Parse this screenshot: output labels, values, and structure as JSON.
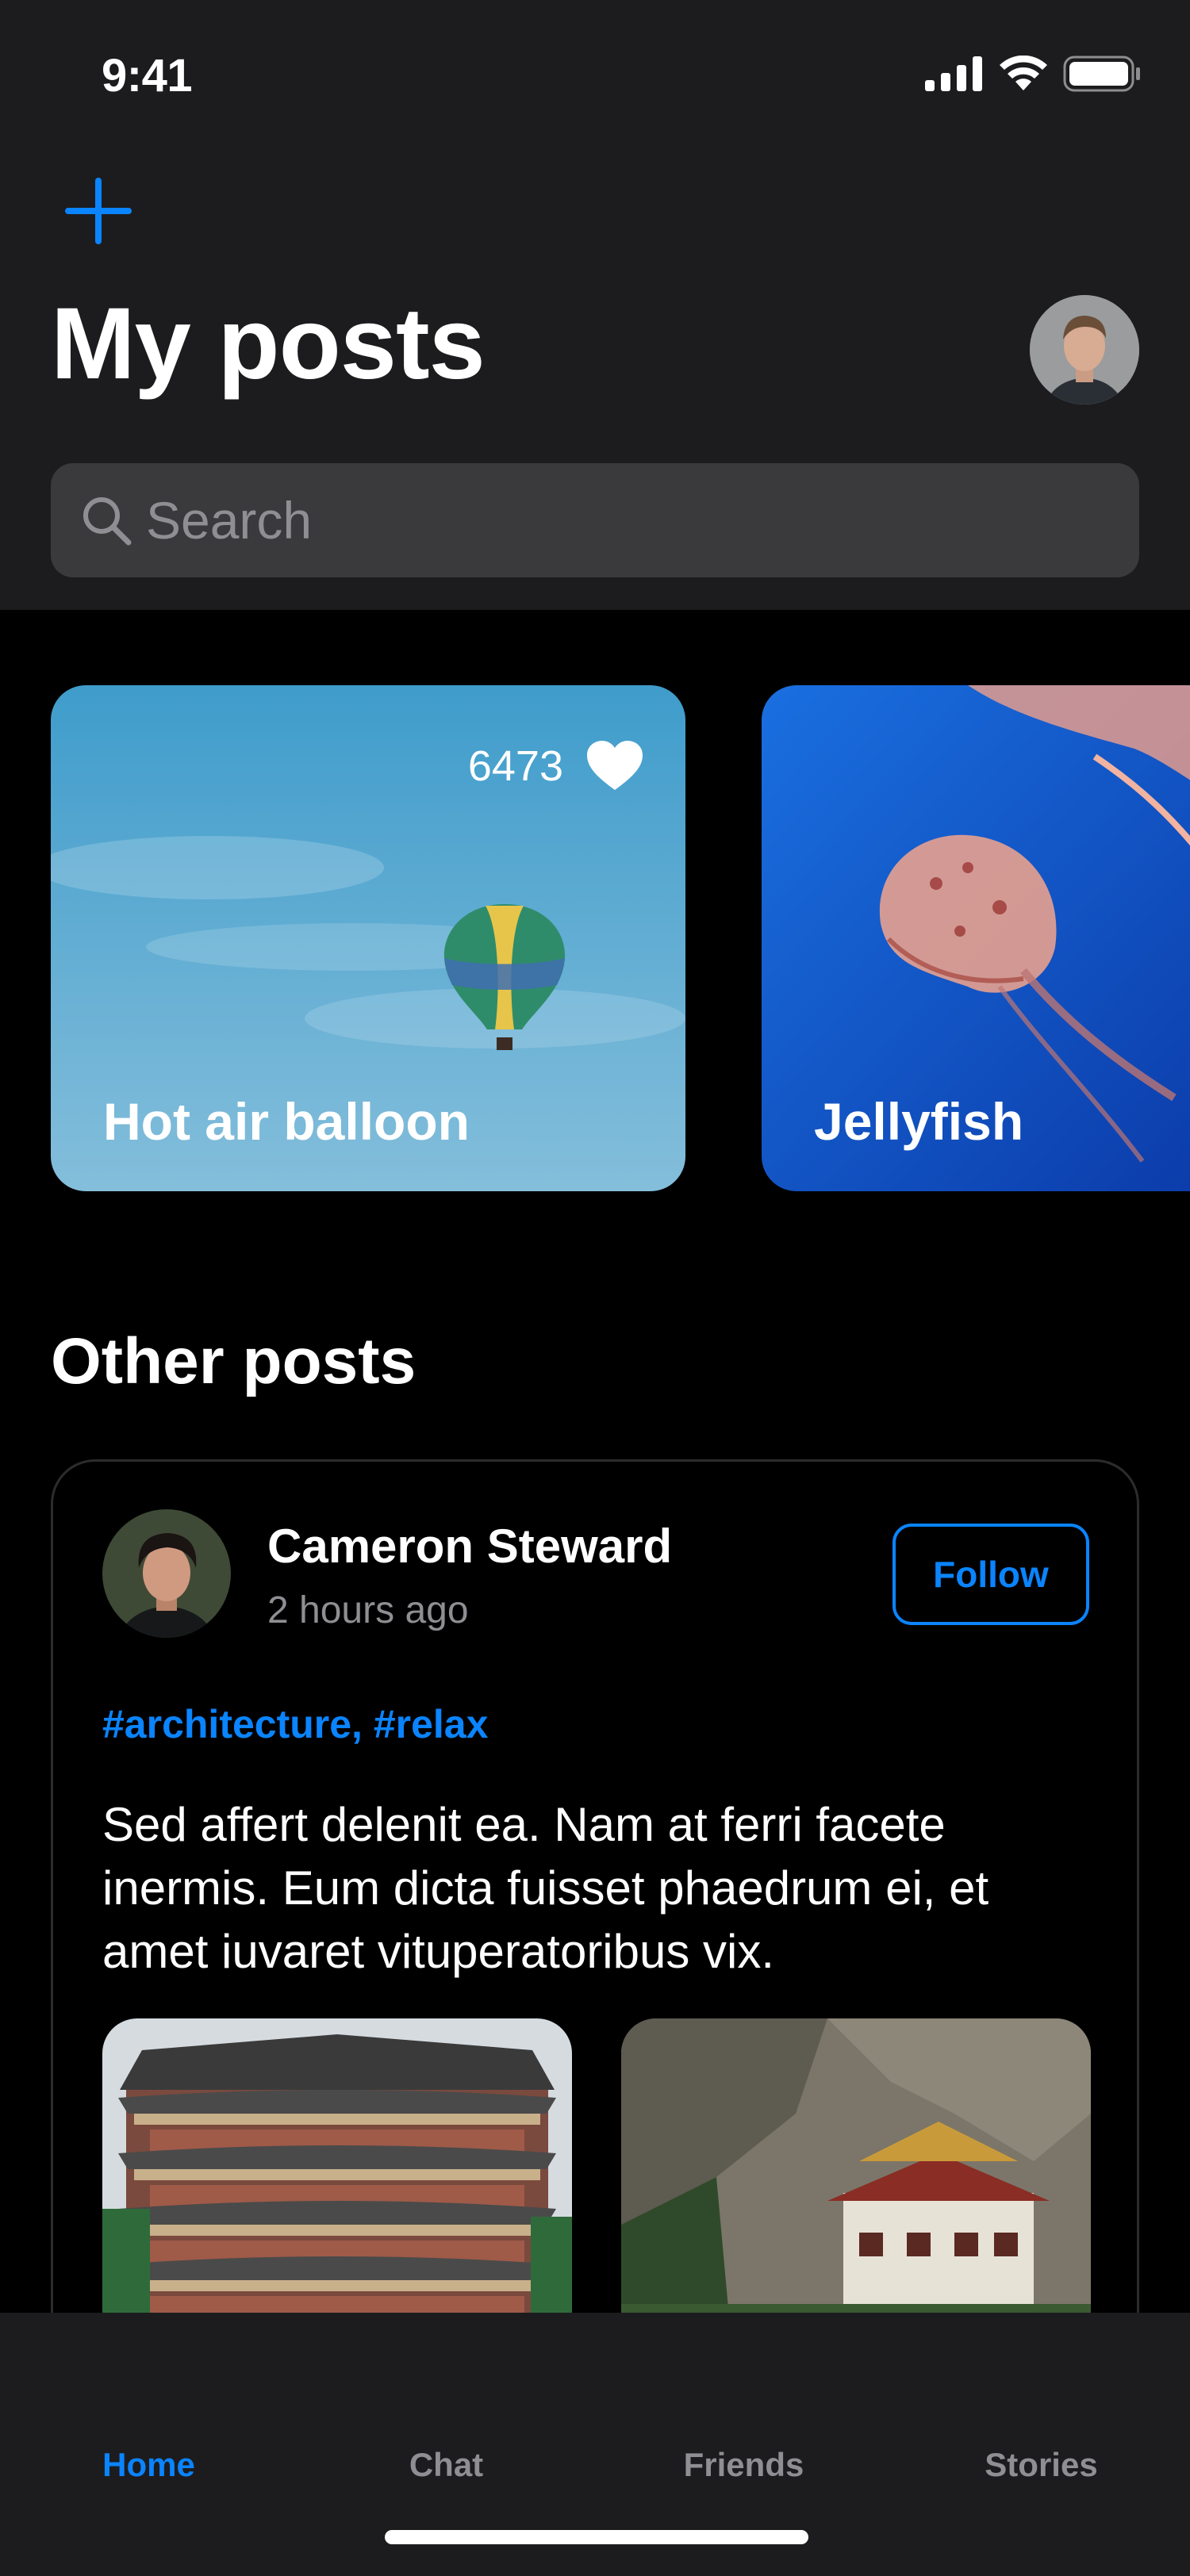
{
  "status_bar": {
    "time": "9:41"
  },
  "header": {
    "title": "My posts",
    "add_icon": "plus-icon",
    "search": {
      "placeholder": "Search",
      "value": ""
    }
  },
  "my_posts": [
    {
      "title": "Hot air balloon",
      "likes": "6473",
      "like_icon": "heart-icon"
    },
    {
      "title": "Jellyfish"
    }
  ],
  "other_posts": {
    "title": "Other posts",
    "posts": [
      {
        "author": "Cameron Steward",
        "time": "2 hours ago",
        "follow_label": "Follow",
        "tags": "#architecture, #relax",
        "body": "Sed affert delenit ea. Nam at ferri facete inermis. Eum dicta fuisset phaedrum ei, et amet iuvaret vituperatoribus vix."
      }
    ]
  },
  "tabbar": {
    "tabs": [
      {
        "label": "Home",
        "active": true
      },
      {
        "label": "Chat"
      },
      {
        "label": "Friends"
      },
      {
        "label": "Stories"
      }
    ]
  },
  "colors": {
    "accent": "#0a84ff",
    "surface": "#1c1c1e",
    "background": "#000000"
  }
}
